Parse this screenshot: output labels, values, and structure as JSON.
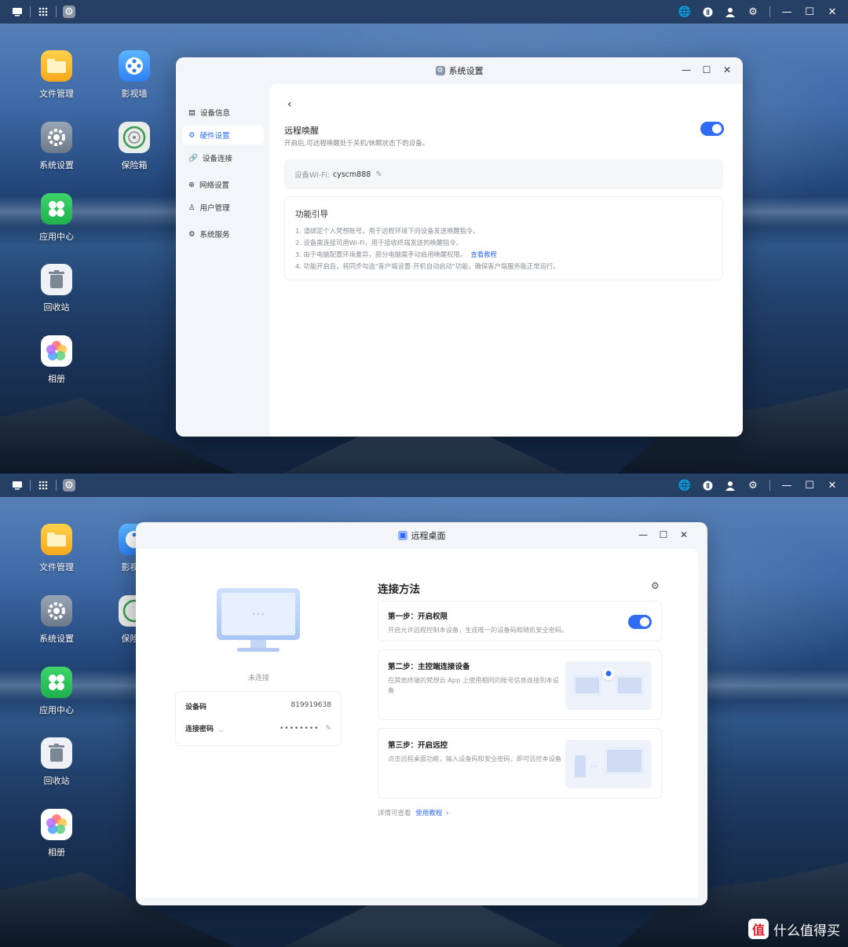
{
  "taskbar": {
    "icons": [
      "desktop-icon",
      "apps-grid-icon",
      "settings-app-icon"
    ],
    "right_icons": [
      "globe-icon",
      "info-icon",
      "user-icon",
      "gear-icon",
      "minimize-icon",
      "maximize-icon",
      "close-icon"
    ]
  },
  "desktop": {
    "icons": [
      {
        "label": "文件管理",
        "icon": "folder-icon"
      },
      {
        "label": "影视墙",
        "icon": "film-reel-icon"
      },
      {
        "label": "系统设置",
        "icon": "gear-icon"
      },
      {
        "label": "保险箱",
        "icon": "safe-icon"
      },
      {
        "label": "应用中心",
        "icon": "app-center-icon"
      },
      {
        "label": "回收站",
        "icon": "trash-icon"
      },
      {
        "label": "相册",
        "icon": "photo-flower-icon"
      }
    ]
  },
  "settings_window": {
    "title": "系统设置",
    "nav": [
      {
        "label": "设备信息",
        "icon": "device-info-icon"
      },
      {
        "label": "硬件设置",
        "icon": "hardware-icon",
        "active": true
      },
      {
        "label": "设备连接",
        "icon": "link-icon"
      },
      {
        "label": "网络设置",
        "icon": "globe-icon"
      },
      {
        "label": "用户管理",
        "icon": "user-icon"
      },
      {
        "label": "系统服务",
        "icon": "service-icon"
      }
    ],
    "wake": {
      "title": "远程唤醒",
      "desc": "开启后,可远程唤醒处于关机/休眠状态下的设备。",
      "enabled": true
    },
    "wifi": {
      "label": "设备Wi-Fi:",
      "value": "cyscm888"
    },
    "guide": {
      "title": "功能引导",
      "items": [
        "1. 请绑定个人梵想账号，用于远程环境下向设备发送唤醒指令。",
        "2. 设备需连接可用Wi-Fi，用于接收终端发送的唤醒指令。",
        "3. 由于电脑配置环境差异，部分电脑需手动启用唤醒权限。",
        "4. 功能开启后，将同步勾选\"客户端设置-开机自动启动\"功能，确保客户端服务能正常运行。"
      ],
      "link": "查看教程"
    }
  },
  "remote_window": {
    "title": "远程桌面",
    "status": "未连接",
    "monitor_dots": "···",
    "device_code_label": "设备码",
    "device_code": "819919638",
    "password_label": "连接密码",
    "password": "••••••••",
    "section_title": "连接方法",
    "steps": [
      {
        "title": "第一步：开启权限",
        "desc": "开启允许远程控制本设备，生成唯一的设备码和随机安全密码。",
        "enabled": true
      },
      {
        "title": "第二步：主控端连接设备",
        "desc": "在其他终端的梵想云 App 上使用相同的账号信息连接到本设备"
      },
      {
        "title": "第三步：开启远控",
        "desc": "点击远程桌面功能，输入设备码和安全密码，即可远控本设备"
      }
    ],
    "footer_text": "详情可查看",
    "footer_link": "使用教程"
  },
  "brand": {
    "badge": "值",
    "text": "什么值得买"
  },
  "colors": {
    "accent": "#2f6cf6",
    "desktop_top": "#5d86bd",
    "window_bg": "#f3f5f8"
  }
}
